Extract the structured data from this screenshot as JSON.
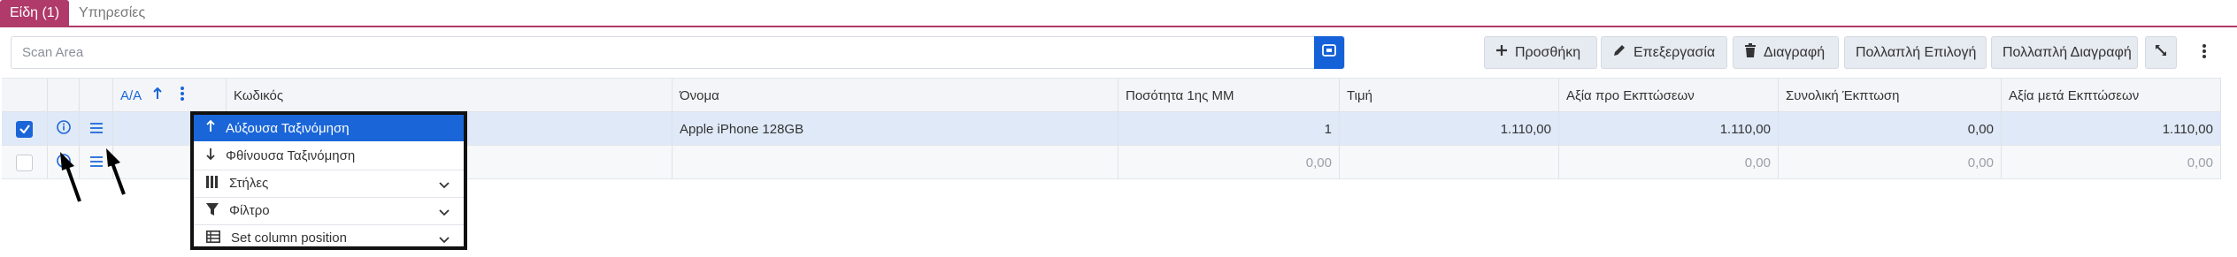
{
  "tabs": [
    {
      "label": "Είδη (1)"
    },
    {
      "label": "Υπηρεσίες"
    }
  ],
  "scan": {
    "placeholder": "Scan Area"
  },
  "toolbar": {
    "add": "Προσθήκη",
    "edit": "Επεξεργασία",
    "delete": "Διαγραφή",
    "multi_select": "Πολλαπλή Επιλογή",
    "multi_delete": "Πολλαπλή Διαγραφή"
  },
  "columns": {
    "aa": "A/A",
    "code": "Κωδικός",
    "name": "Όνομα",
    "qty": "Ποσότητα 1ης ΜΜ",
    "price": "Τιμή",
    "value_before": "Αξία προ Εκπτώσεων",
    "total_discount": "Συνολική Έκπτωση",
    "value_after": "Αξία μετά Εκπτώσεων"
  },
  "rows": [
    {
      "selected": true,
      "name": "Apple iPhone 128GB",
      "qty": "1",
      "price": "1.110,00",
      "value_before": "1.110,00",
      "total_discount": "0,00",
      "value_after": "1.110,00"
    },
    {
      "selected": false,
      "name": "",
      "qty": "0,00",
      "price": "",
      "value_before": "0,00",
      "total_discount": "0,00",
      "value_after": "0,00"
    }
  ],
  "menu": {
    "sort_asc": "Αύξουσα Ταξινόμηση",
    "sort_desc": "Φθίνουσα Ταξινόμηση",
    "columns": "Στήλες",
    "filter": "Φίλτρο",
    "set_column_position": "Set column position"
  },
  "colors": {
    "accent": "#b03a6a",
    "primary": "#1a66d8",
    "highlight": "#dfe9f8"
  }
}
